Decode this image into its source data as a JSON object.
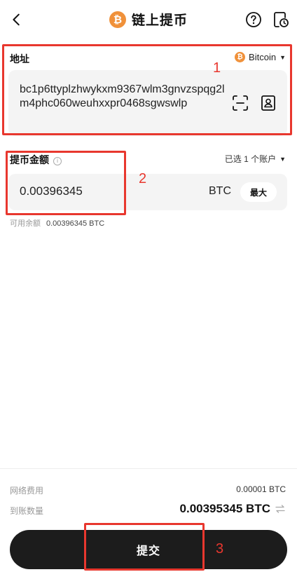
{
  "header": {
    "title": "链上提币",
    "coin_glyph": "₿",
    "icons": {
      "back": "chevron-left-icon",
      "help": "question-circle-icon",
      "history": "order-history-icon"
    }
  },
  "address": {
    "label": "地址",
    "network": "Bitcoin",
    "value": "bc1p6ttyplzhwykxm9367wlm3gnvzspqg2lm4phc060weuhxxpr0468sgwswlp",
    "icons": {
      "scan": "scan-icon",
      "address_book": "address-book-icon"
    }
  },
  "amount": {
    "label": "提币金额",
    "info_glyph": "i",
    "account_select": "已选 1 个账户",
    "value": "0.00396345",
    "unit": "BTC",
    "max_label": "最大",
    "available_label": "可用余额",
    "available_value": "0.00396345 BTC"
  },
  "summary": {
    "fee_label": "网络费用",
    "fee_value": "0.00001 BTC",
    "receive_label": "到账数量",
    "receive_value": "0.00395345 BTC"
  },
  "submit": {
    "label": "提交"
  },
  "annotations": {
    "one": "1",
    "two": "2",
    "three": "3"
  },
  "colors": {
    "btc_orange": "#f0913a",
    "annotation_red": "#e8372e",
    "button_dark": "#1c1c1c"
  }
}
